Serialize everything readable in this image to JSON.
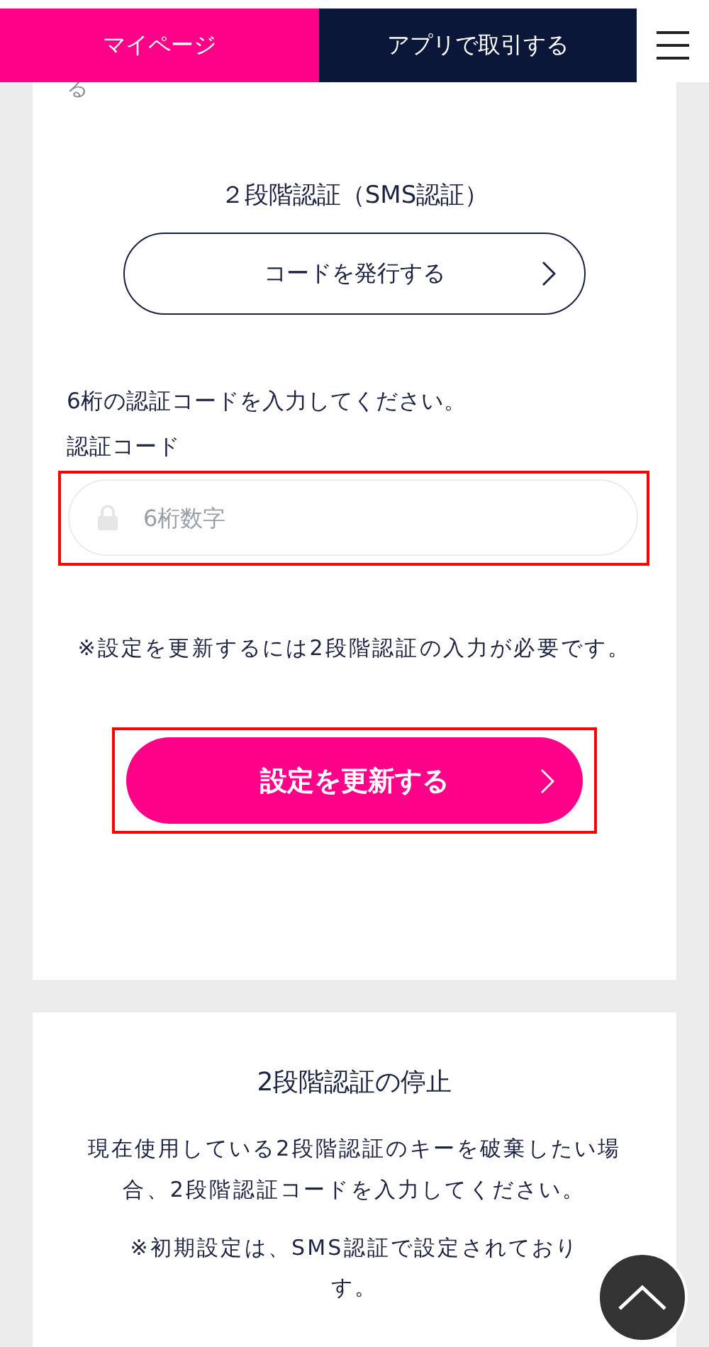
{
  "header": {
    "tabs": [
      {
        "label": "マイページ",
        "kind": "primary"
      },
      {
        "label": "アプリで取引する",
        "kind": "dark"
      }
    ]
  },
  "verify_card": {
    "cut_text": "る",
    "title": "２段階認証（SMS認証）",
    "issue_button": {
      "label": "コードを発行する"
    },
    "instruction": "6桁の認証コードを入力してください。",
    "field": {
      "label": "認証コード",
      "placeholder": "6桁数字",
      "highlighted": true
    },
    "note": "※設定を更新するには2段階認証の入力が必要です。",
    "submit_button": {
      "label": "設定を更新する",
      "highlighted": true
    }
  },
  "stop_card": {
    "title": "2段階認証の停止",
    "description": "現在使用している2段階認証のキーを破棄したい場合、2段階認証コードを入力してください。",
    "note_lines": [
      "※初期設定は、SMS認証で設定されており",
      "す。"
    ]
  }
}
